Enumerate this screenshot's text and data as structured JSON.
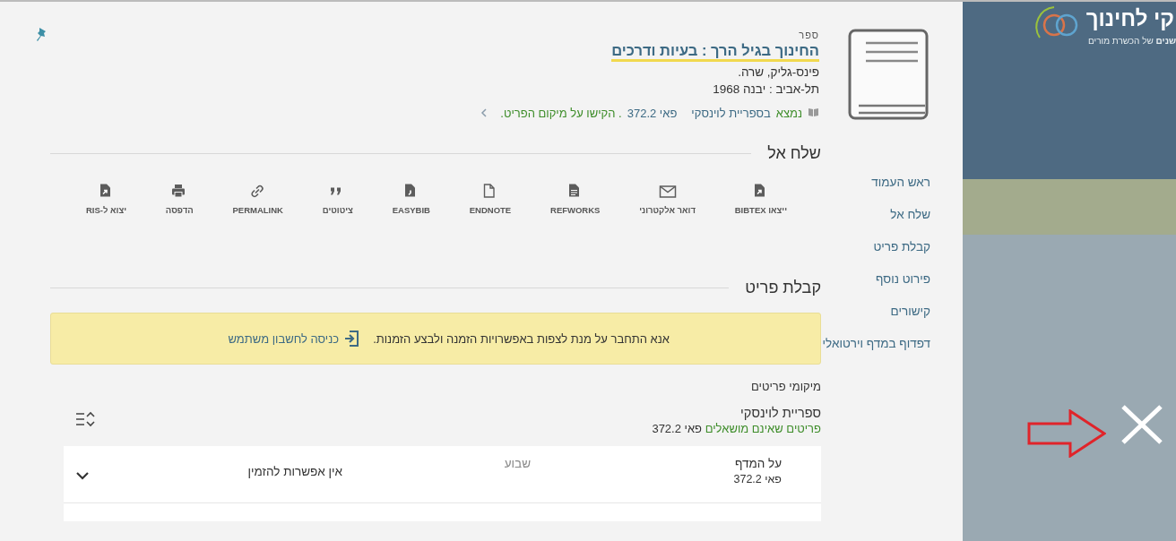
{
  "record": {
    "type_label": "ספר",
    "title": "החינוך בגיל הרך : בעיות ודרכים",
    "author": "פינס-גליק, שרה.",
    "publication": "תל-אביב : יבנה 1968",
    "availability": {
      "status": "נמצא",
      "location": "בספריית לוינסקי",
      "call_number": "פאי 372.2",
      "note": ". הקישו על מיקום הפריט."
    }
  },
  "nav": {
    "items": [
      {
        "label": "ראש העמוד"
      },
      {
        "label": "שלח אל"
      },
      {
        "label": "קבלת פריט"
      },
      {
        "label": "פירוט נוסף"
      },
      {
        "label": "קישורים"
      },
      {
        "label": "דפדוף במדף וירטואלי"
      }
    ]
  },
  "send_to": {
    "heading": "שלח אל",
    "actions": [
      {
        "label": "ייצאו BIBTEX",
        "kind": "export"
      },
      {
        "label": "דואר אלקטרוני",
        "kind": "email"
      },
      {
        "label": "REFWORKS",
        "kind": "lines-doc"
      },
      {
        "label": "ENDNOTE",
        "kind": "doc"
      },
      {
        "label": "EASYBIB",
        "kind": "easybib"
      },
      {
        "label": "ציטוטים",
        "kind": "quote"
      },
      {
        "label": "PERMALINK",
        "kind": "link"
      },
      {
        "label": "הדפסה",
        "kind": "print"
      },
      {
        "label": "יצוא ל-RIS",
        "kind": "export"
      }
    ]
  },
  "get_it": {
    "heading": "קבלת פריט",
    "alert": {
      "message": "אנא התחבר על מנת לצפות באפשרויות הזמנה ולבצע הזמנות.",
      "login_link": "כניסה לחשבון משתמש"
    },
    "locations_label": "מיקומי פריטים",
    "library": "ספריית לוינסקי",
    "availability": "פריטים שאינם מושאלים",
    "call_number": "פאי 372.2",
    "items": [
      {
        "location": "על המדף",
        "call_number": "פאי 372.2",
        "loan": "שבוע",
        "request": "אין אפשרות להזמין",
        "expanded": false
      }
    ]
  },
  "background_site": {
    "logo_name": "קי לחינוך",
    "tagline_bold": "שנים",
    "tagline": "של הכשרת מורים"
  }
}
